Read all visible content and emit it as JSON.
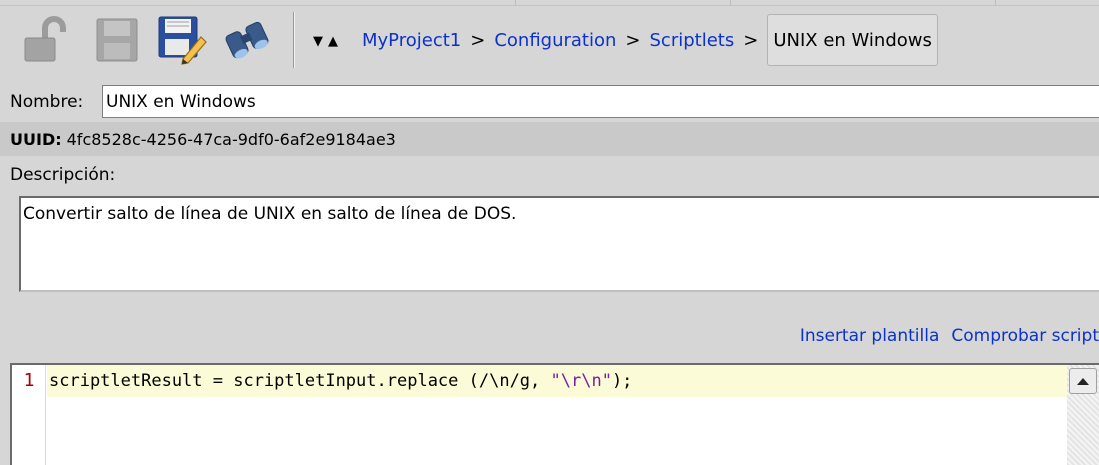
{
  "toolbar": {
    "icons": [
      "unlock-icon",
      "save-disabled-icon",
      "save-edit-icon",
      "binoculars-icon"
    ],
    "nav_down": "▼",
    "nav_up": "▲"
  },
  "breadcrumb": {
    "items": [
      "MyProject1",
      "Configuration",
      "Scriptlets"
    ],
    "separator": ">",
    "current": "UNIX en Windows"
  },
  "form": {
    "name_label": "Nombre:",
    "name_value": "UNIX en Windows",
    "uuid_label": "UUID:",
    "uuid_value": "4fc8528c-4256-47ca-9df0-6af2e9184ae3",
    "description_label": "Descripción:",
    "description_value": "Convertir salto de línea de UNIX en salto de línea de DOS."
  },
  "links": {
    "insert_template": "Insertar plantilla",
    "check_script": "Comprobar script"
  },
  "editor": {
    "line_number": "1",
    "code_before": "scriptletResult = scriptletInput.replace (/\\n/g, ",
    "code_string": "\"\\r\\n\"",
    "code_after": ");"
  },
  "colors": {
    "link": "#0b32c9",
    "line_number": "#b00000",
    "string": "#7a1ea1",
    "current_line": "#fbfbd8"
  }
}
